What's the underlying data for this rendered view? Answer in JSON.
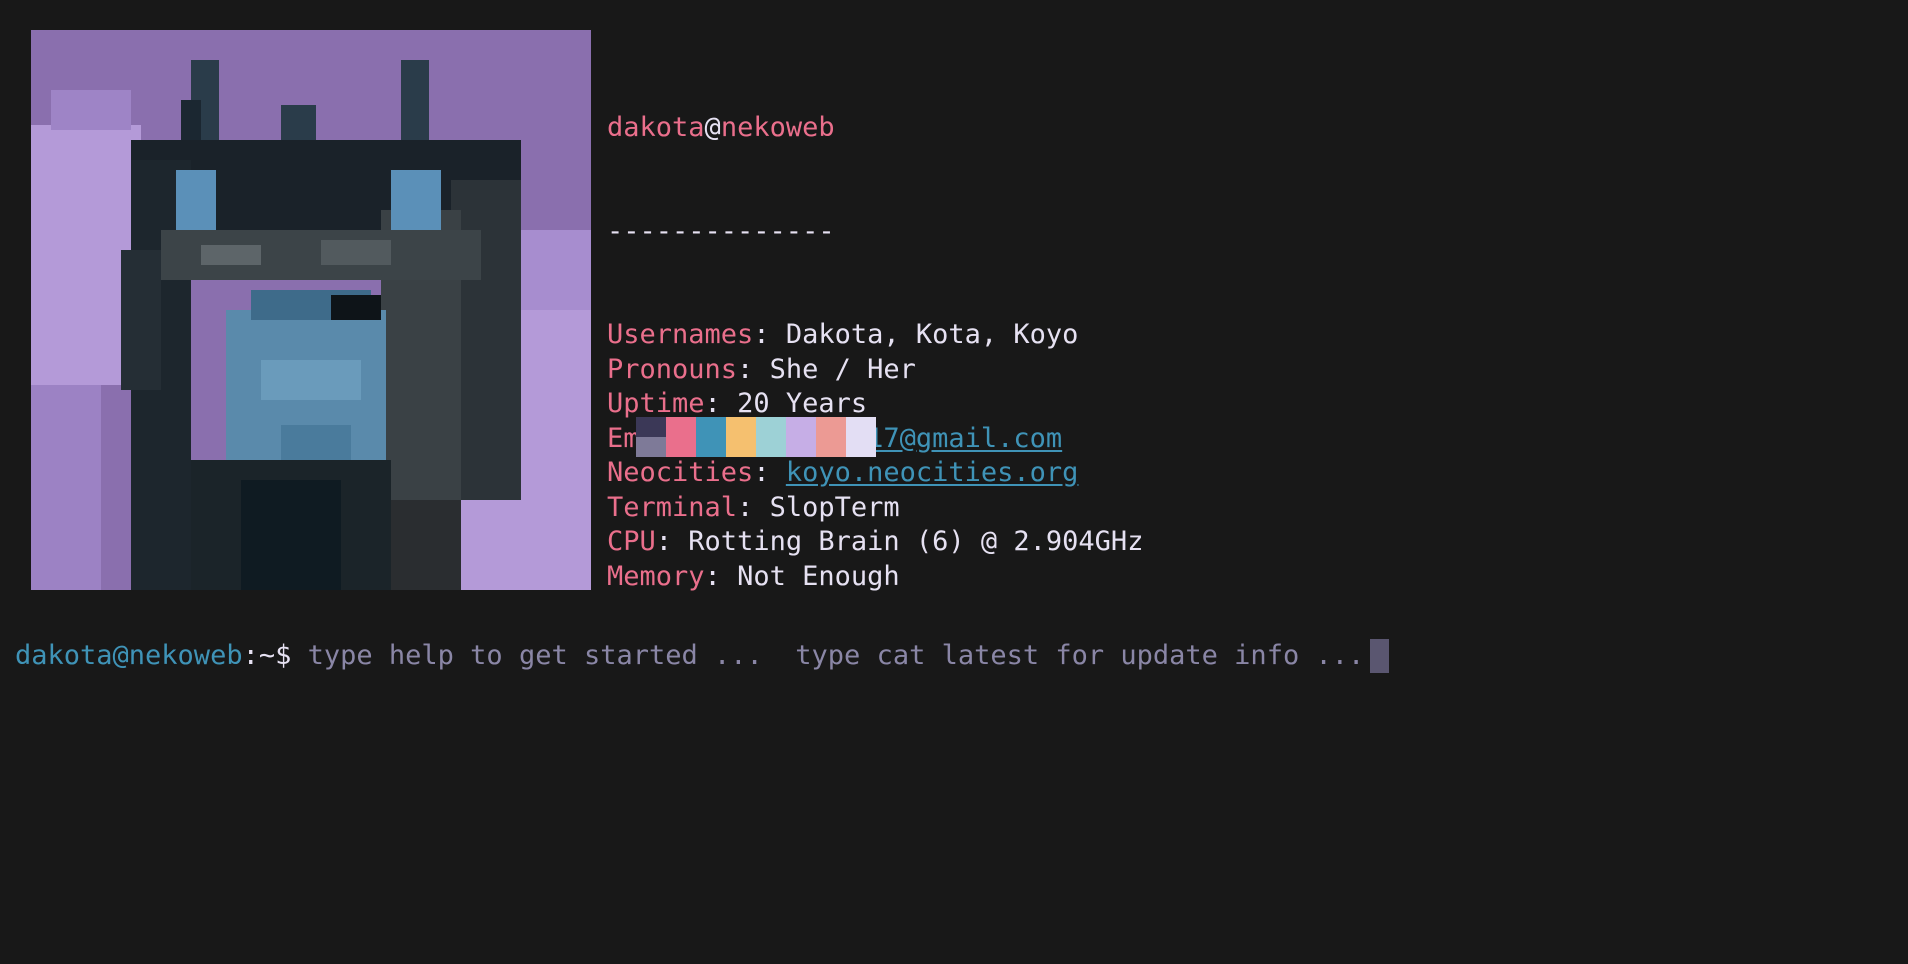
{
  "avatar": {
    "alt": "pixel art avatar"
  },
  "fetch": {
    "user": "dakota",
    "at": "@",
    "host": "nekoweb",
    "separator": "--------------",
    "rows": [
      {
        "key": "Usernames",
        "value": "Dakota, Kota, Koyo",
        "is_link": false
      },
      {
        "key": "Pronouns",
        "value": "She / Her",
        "is_link": false
      },
      {
        "key": "Uptime",
        "value": "20 Years",
        "is_link": false
      },
      {
        "key": "Email",
        "value": "dakotashi17@gmail.com",
        "is_link": true
      },
      {
        "key": "Neocities",
        "value": "koyo.neocities.org",
        "is_link": true
      },
      {
        "key": "Terminal",
        "value": "SlopTerm",
        "is_link": false
      },
      {
        "key": "CPU",
        "value": "Rotting Brain (6) @ 2.904GHz",
        "is_link": false
      },
      {
        "key": "Memory",
        "value": "Not Enough",
        "is_link": false
      }
    ],
    "colon": ": "
  },
  "palette": [
    "#3b3857",
    "#ea6f8c",
    "#3f93b7",
    "#f5c06f",
    "#9dd1d6",
    "#c6aee6",
    "#ec9a94",
    "#e3def4"
  ],
  "prompt": {
    "host": "dakota@nekoweb",
    "path": ":~$",
    "hint": "type help to get started ...  type cat latest for update info ..."
  },
  "colors": {
    "accent_pink": "#ea6f8c",
    "accent_blue": "#3f93b7",
    "background": "#181818",
    "foreground": "#e6e1f2",
    "muted": "#8a86a6"
  }
}
